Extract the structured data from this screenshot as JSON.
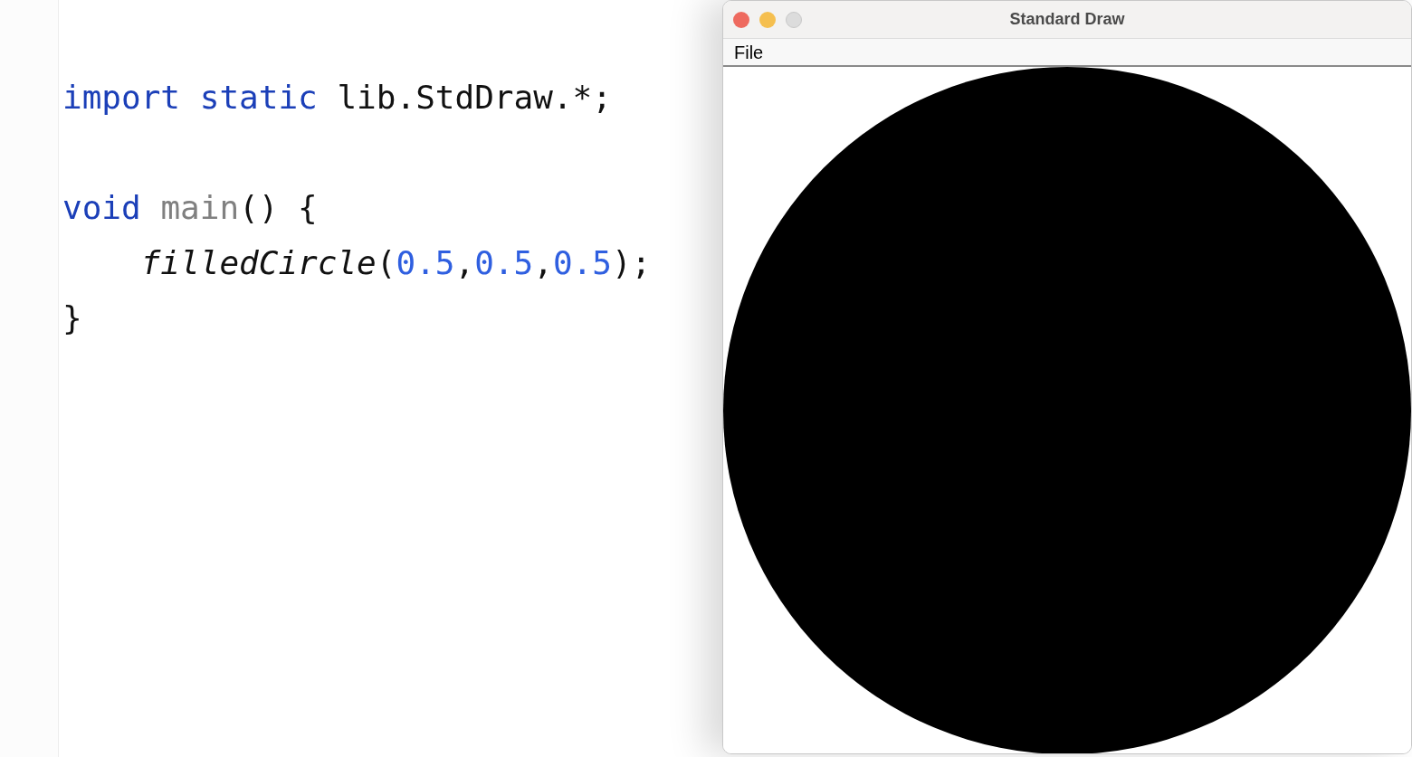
{
  "editor": {
    "blocks": [
      {
        "lines": [
          {
            "tokens": [
              {
                "text": "import",
                "kind": "keyword"
              },
              {
                "text": " static",
                "kind": "keyword"
              },
              {
                "text": " lib.StdDraw.*;",
                "kind": "plain"
              }
            ]
          }
        ]
      },
      {
        "lines": [
          {
            "tokens": [
              {
                "text": "void",
                "kind": "keyword"
              },
              {
                "text": " main",
                "kind": "declaration"
              },
              {
                "text": "() {",
                "kind": "plain"
              }
            ]
          },
          {
            "tokens": [
              {
                "text": "    filledCircle",
                "kind": "static_call"
              },
              {
                "text": "(",
                "kind": "plain"
              },
              {
                "text": "0.5",
                "kind": "number"
              },
              {
                "text": ",",
                "kind": "plain"
              },
              {
                "text": "0.5",
                "kind": "number"
              },
              {
                "text": ",",
                "kind": "plain"
              },
              {
                "text": "0.5",
                "kind": "number"
              },
              {
                "text": ");",
                "kind": "plain"
              }
            ]
          },
          {
            "tokens": [
              {
                "text": "}",
                "kind": "plain"
              }
            ]
          }
        ]
      }
    ]
  },
  "window": {
    "title": "Standard Draw",
    "menu": [
      "File"
    ]
  }
}
